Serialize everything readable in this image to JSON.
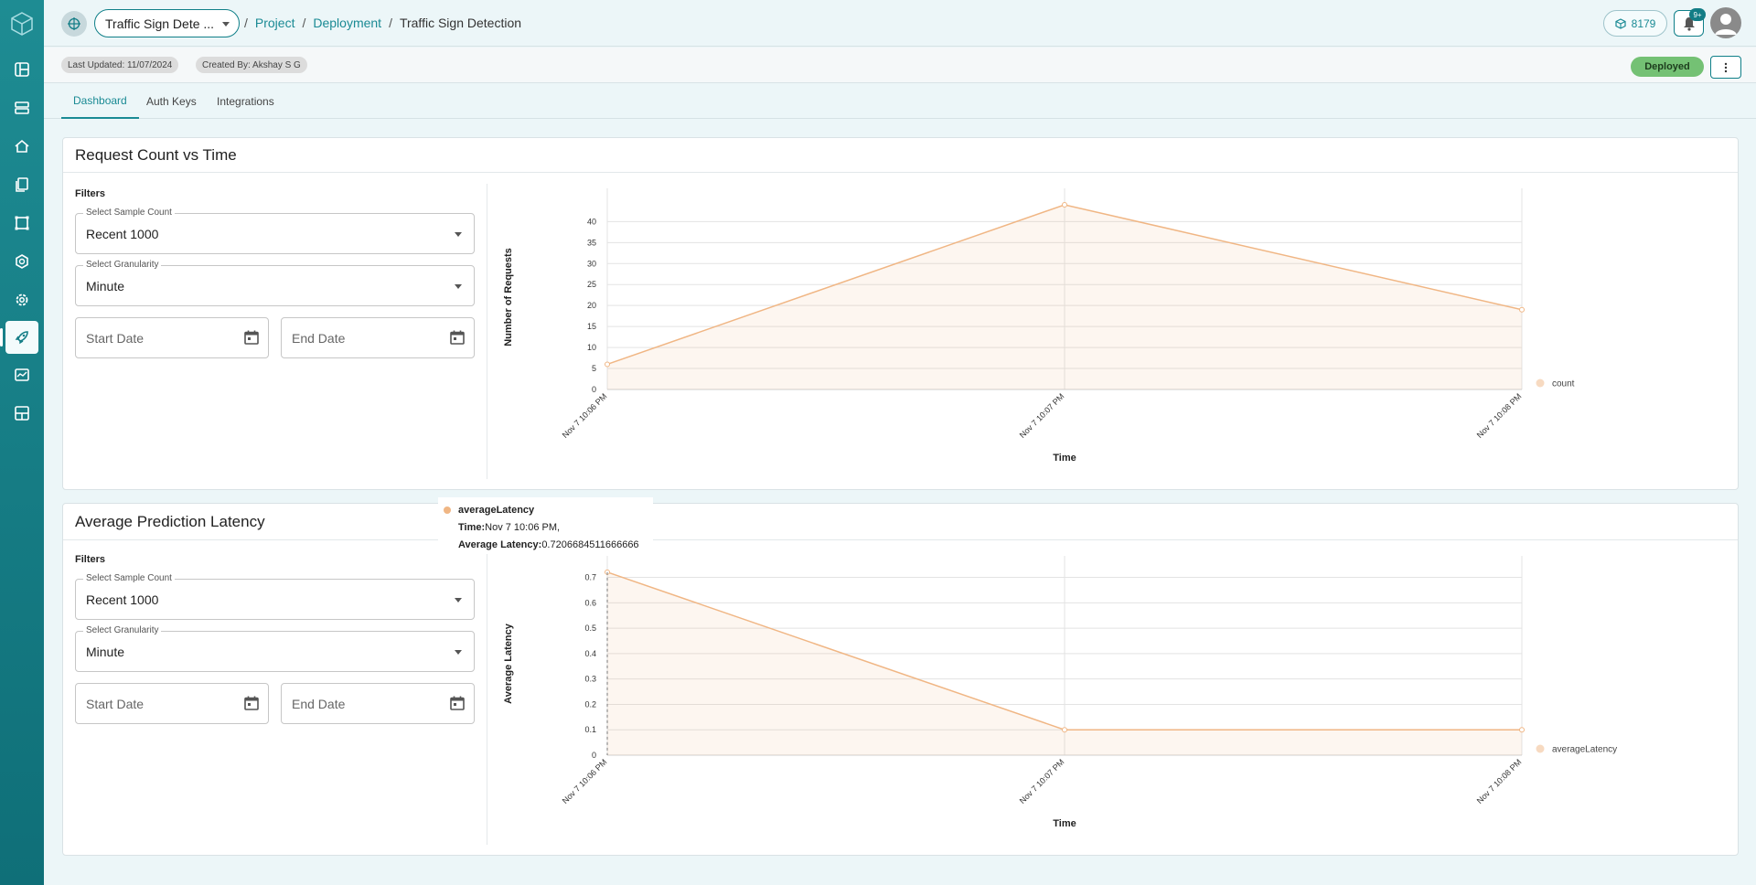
{
  "topbar": {
    "project_select": "Traffic Sign Dete ...",
    "breadcrumb": {
      "project": "Project",
      "deployment": "Deployment",
      "current": "Traffic Sign Detection",
      "separator": "/"
    },
    "credits": "8179",
    "notifications_badge": "9+"
  },
  "info": {
    "last_updated": "Last Updated: 11/07/2024",
    "created_by": "Created By: Akshay S G",
    "status": "Deployed"
  },
  "tabs": [
    {
      "label": "Dashboard",
      "active": true
    },
    {
      "label": "Auth Keys",
      "active": false
    },
    {
      "label": "Integrations",
      "active": false
    }
  ],
  "cards": [
    {
      "title": "Request Count vs Time",
      "filters_title": "Filters",
      "sample_count": {
        "label": "Select Sample Count",
        "value": "Recent 1000"
      },
      "granularity": {
        "label": "Select Granularity",
        "value": "Minute"
      },
      "start_date": {
        "placeholder": "Start Date"
      },
      "end_date": {
        "placeholder": "End Date"
      }
    },
    {
      "title": "Average Prediction Latency",
      "filters_title": "Filters",
      "sample_count": {
        "label": "Select Sample Count",
        "value": "Recent 1000"
      },
      "granularity": {
        "label": "Select Granularity",
        "value": "Minute"
      },
      "start_date": {
        "placeholder": "Start Date"
      },
      "end_date": {
        "placeholder": "End Date"
      }
    }
  ],
  "tooltip": {
    "series": "averageLatency",
    "time_label": "Time:",
    "time_value": "Nov 7 10:06 PM,",
    "latency_label": "Average Latency:",
    "latency_value": "0.7206684511666666"
  },
  "colors": {
    "accent": "#1a8a94",
    "series": "#f0b684",
    "deployed": "#74c174"
  },
  "chart_data": [
    {
      "type": "area",
      "x": [
        "Nov 7 10:06 PM",
        "Nov 7 10:07 PM",
        "Nov 7 10:08 PM"
      ],
      "series": [
        {
          "name": "count",
          "values": [
            6,
            44,
            19
          ]
        }
      ],
      "xlabel": "Time",
      "ylabel": "Number of Requests",
      "yticks": [
        "0",
        "5",
        "10",
        "15",
        "20",
        "25",
        "30",
        "35",
        "40"
      ],
      "ylim": [
        0,
        44
      ],
      "grid": true,
      "legend": "right"
    },
    {
      "type": "area",
      "x": [
        "Nov 7 10:06 PM",
        "Nov 7 10:07 PM",
        "Nov 7 10:08 PM"
      ],
      "series": [
        {
          "name": "averageLatency",
          "values": [
            0.7206684511666666,
            0.1,
            0.1
          ]
        }
      ],
      "xlabel": "Time",
      "ylabel": "Average Latency",
      "yticks": [
        "0",
        "0.1",
        "0.2",
        "0.3",
        "0.4",
        "0.5",
        "0.6",
        "0.7"
      ],
      "ylim": [
        0,
        0.72
      ],
      "grid": true,
      "legend": "right"
    }
  ]
}
